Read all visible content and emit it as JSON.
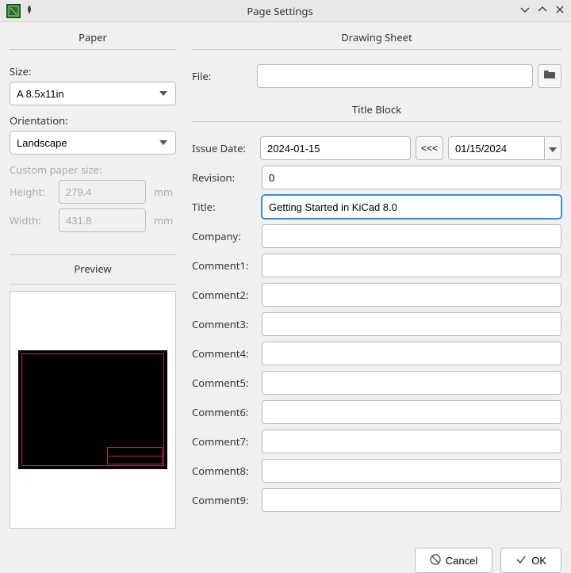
{
  "window": {
    "title": "Page Settings"
  },
  "paper": {
    "header": "Paper",
    "size_label": "Size:",
    "size_value": "A 8.5x11in",
    "orientation_label": "Orientation:",
    "orientation_value": "Landscape",
    "custom_label": "Custom paper size:",
    "height_label": "Height:",
    "height_value": "279.4",
    "width_label": "Width:",
    "width_value": "431.8",
    "unit": "mm",
    "preview_header": "Preview"
  },
  "drawing_sheet": {
    "header": "Drawing Sheet",
    "file_label": "File:",
    "file_value": ""
  },
  "title_block": {
    "header": "Title Block",
    "issue_date_label": "Issue Date:",
    "issue_date_value": "2024-01-15",
    "arrow_label": "<<<",
    "date_picker_value": "01/15/2024",
    "revision_label": "Revision:",
    "revision_value": "0",
    "title_label": "Title:",
    "title_value": "Getting Started in KiCad 8.0",
    "company_label": "Company:",
    "company_value": "",
    "comment1_label": "Comment1:",
    "comment1_value": "",
    "comment2_label": "Comment2:",
    "comment2_value": "",
    "comment3_label": "Comment3:",
    "comment3_value": "",
    "comment4_label": "Comment4:",
    "comment4_value": "",
    "comment5_label": "Comment5:",
    "comment5_value": "",
    "comment6_label": "Comment6:",
    "comment6_value": "",
    "comment7_label": "Comment7:",
    "comment7_value": "",
    "comment8_label": "Comment8:",
    "comment8_value": "",
    "comment9_label": "Comment9:",
    "comment9_value": ""
  },
  "buttons": {
    "cancel": "Cancel",
    "ok": "OK"
  }
}
